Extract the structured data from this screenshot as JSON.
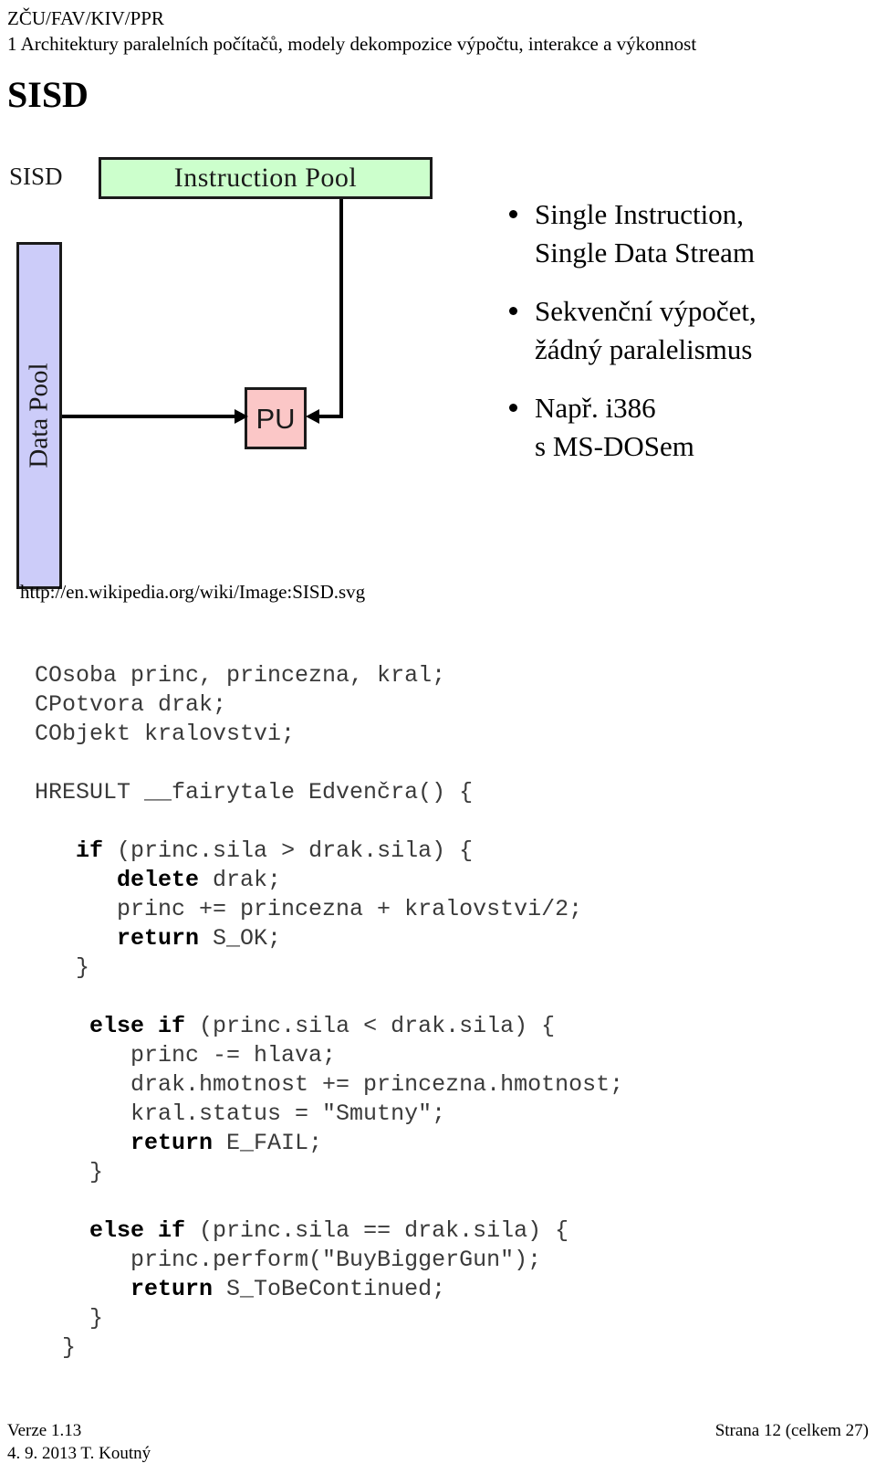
{
  "header": {
    "org_line": "ZČU/FAV/KIV/PPR",
    "chapter_line": "1 Architektury paralelních počítačů, modely dekompozice výpočtu, interakce a výkonnost"
  },
  "page_title": "SISD",
  "diagram": {
    "corner_label": "SISD",
    "instruction_pool_label": "Instruction Pool",
    "data_pool_label": "Data Pool",
    "pu_label": "PU",
    "source_url": "http://en.wikipedia.org/wiki/Image:SISD.svg",
    "colors": {
      "instruction_pool_fill": "#ccffcc",
      "data_pool_fill": "#ccccf9",
      "pu_fill": "#fbc7c7",
      "stroke": "#1a1a1a"
    }
  },
  "bullets": [
    "Single Instruction,\nSingle Data Stream",
    "Sekvenční výpočet,\nžádný paralelismus",
    "Např. i386\ns MS-DOSem"
  ],
  "code": {
    "lines": [
      [
        {
          "t": "COsoba princ, princezna, kral;",
          "b": false
        }
      ],
      [
        {
          "t": "CPotvora drak;",
          "b": false
        }
      ],
      [
        {
          "t": "CObjekt kralovstvi;",
          "b": false
        }
      ],
      [
        {
          "t": "",
          "b": false
        }
      ],
      [
        {
          "t": "HRESULT __fairytale Edvenčra() {",
          "b": false
        }
      ],
      [
        {
          "t": "",
          "b": false
        }
      ],
      [
        {
          "t": "   ",
          "b": false
        },
        {
          "t": "if",
          "b": true
        },
        {
          "t": " (princ.sila > drak.sila) {",
          "b": false
        }
      ],
      [
        {
          "t": "      ",
          "b": false
        },
        {
          "t": "delete",
          "b": true
        },
        {
          "t": " drak;",
          "b": false
        }
      ],
      [
        {
          "t": "      princ += princezna + kralovstvi/2;",
          "b": false
        }
      ],
      [
        {
          "t": "      ",
          "b": false
        },
        {
          "t": "return",
          "b": true
        },
        {
          "t": " S_OK;",
          "b": false
        }
      ],
      [
        {
          "t": "   }",
          "b": false
        }
      ],
      [
        {
          "t": "",
          "b": false
        }
      ],
      [
        {
          "t": "    ",
          "b": false
        },
        {
          "t": "else if",
          "b": true
        },
        {
          "t": " (princ.sila < drak.sila) {",
          "b": false
        }
      ],
      [
        {
          "t": "       princ -= hlava;",
          "b": false
        }
      ],
      [
        {
          "t": "       drak.hmotnost += princezna.hmotnost;",
          "b": false
        }
      ],
      [
        {
          "t": "       kral.status = \"Smutny\";",
          "b": false
        }
      ],
      [
        {
          "t": "       ",
          "b": false
        },
        {
          "t": "return",
          "b": true
        },
        {
          "t": " E_FAIL;",
          "b": false
        }
      ],
      [
        {
          "t": "    }",
          "b": false
        }
      ],
      [
        {
          "t": "",
          "b": false
        }
      ],
      [
        {
          "t": "    ",
          "b": false
        },
        {
          "t": "else if",
          "b": true
        },
        {
          "t": " (princ.sila == drak.sila) {",
          "b": false
        }
      ],
      [
        {
          "t": "       princ.perform(\"BuyBiggerGun\");",
          "b": false
        }
      ],
      [
        {
          "t": "       ",
          "b": false
        },
        {
          "t": "return",
          "b": true
        },
        {
          "t": " S_ToBeContinued;",
          "b": false
        }
      ],
      [
        {
          "t": "    }",
          "b": false
        }
      ],
      [
        {
          "t": "  }",
          "b": false
        }
      ]
    ]
  },
  "footer": {
    "version": "Verze 1.13",
    "date_author": "4. 9. 2013 T. Koutný",
    "page_info": "Strana 12 (celkem 27)"
  }
}
